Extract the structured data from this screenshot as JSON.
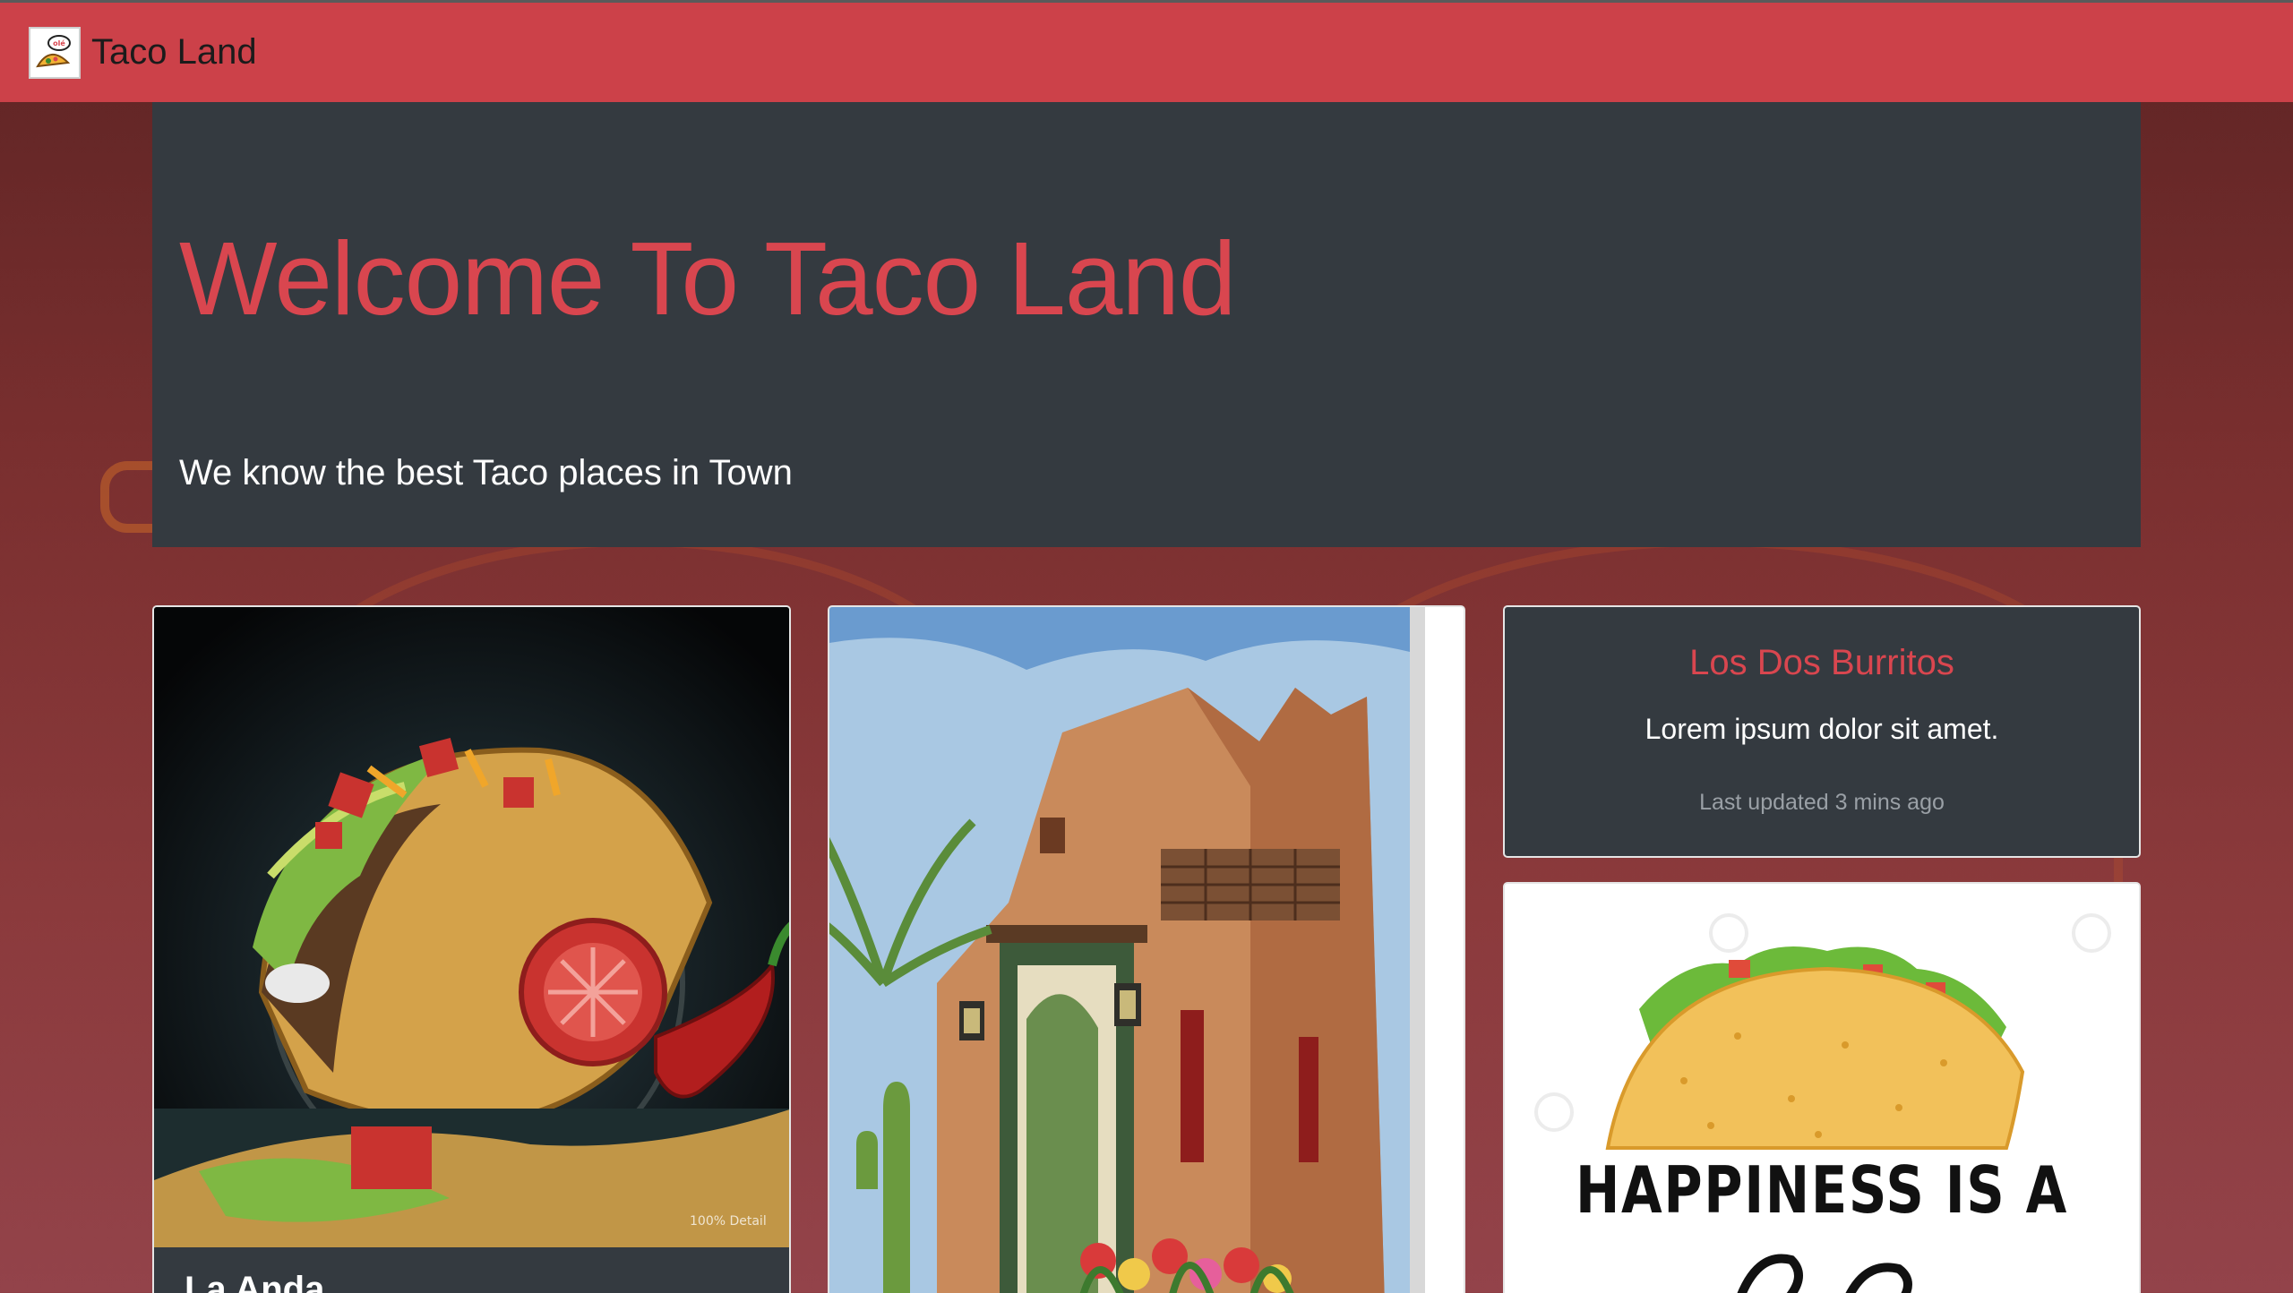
{
  "navbar": {
    "brand": "Taco Land",
    "logo_icon": "taco-logo-icon"
  },
  "jumbotron": {
    "title": "Welcome To Taco Land",
    "lead": "We know the best Taco places in Town"
  },
  "cards": {
    "first": {
      "image_icon": "taco-chalk-illustration",
      "image_caption": "100% Detail",
      "title_partial": "La Anda"
    },
    "second": {
      "image_icon": "adobe-doorway-painting"
    },
    "third": {
      "title": "Los Dos Burritos",
      "text": "Lorem ipsum dolor sit amet.",
      "muted": "Last updated 3 mins ago"
    },
    "fourth": {
      "image_icon": "taco-happiness-poster",
      "poster_text": "HAPPINESS IS A"
    }
  },
  "colors": {
    "navbar": "#cc4149",
    "jumbotron": "#343a40",
    "accent_red": "#d9464f"
  }
}
